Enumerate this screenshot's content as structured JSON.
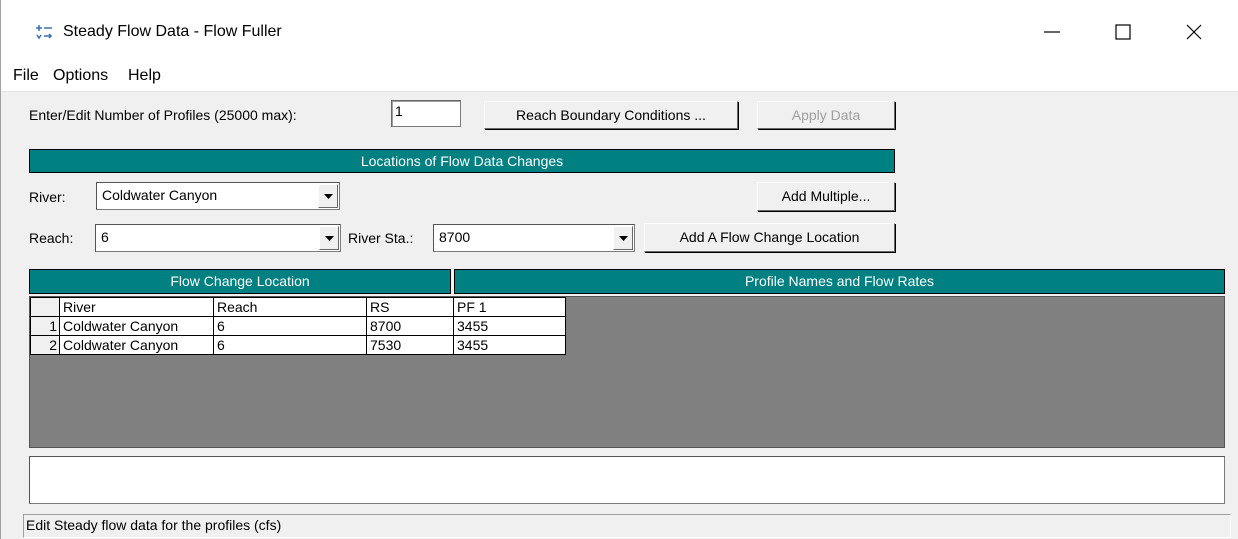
{
  "window": {
    "title": "Steady Flow Data - Flow Fuller"
  },
  "menu": [
    "File",
    "Options",
    "Help"
  ],
  "profiles": {
    "label": "Enter/Edit Number of Profiles (25000 max):",
    "value": "1"
  },
  "buttons": {
    "reach_boundary": "Reach Boundary Conditions ...",
    "apply_data": "Apply Data",
    "add_multiple": "Add Multiple...",
    "add_flow_change": "Add A Flow Change Location"
  },
  "locations": {
    "header": "Locations of Flow Data Changes",
    "river_label": "River:",
    "river_value": "Coldwater Canyon",
    "reach_label": "Reach:",
    "reach_value": "6",
    "station_label": "River Sta.:",
    "station_value": "8700"
  },
  "grid": {
    "left_header": "Flow Change Location",
    "right_header": "Profile Names and Flow Rates",
    "columns": [
      "River",
      "Reach",
      "RS",
      "PF 1"
    ],
    "rows": [
      {
        "num": "1",
        "river": "Coldwater Canyon",
        "reach": "6",
        "rs": "8700",
        "pf1": "3455"
      },
      {
        "num": "2",
        "river": "Coldwater Canyon",
        "reach": "6",
        "rs": "7530",
        "pf1": "3455"
      }
    ]
  },
  "status_text": "Edit Steady flow data for the profiles (cfs)",
  "colors": {
    "header_bar": "#008080",
    "grid_background": "#808080"
  }
}
